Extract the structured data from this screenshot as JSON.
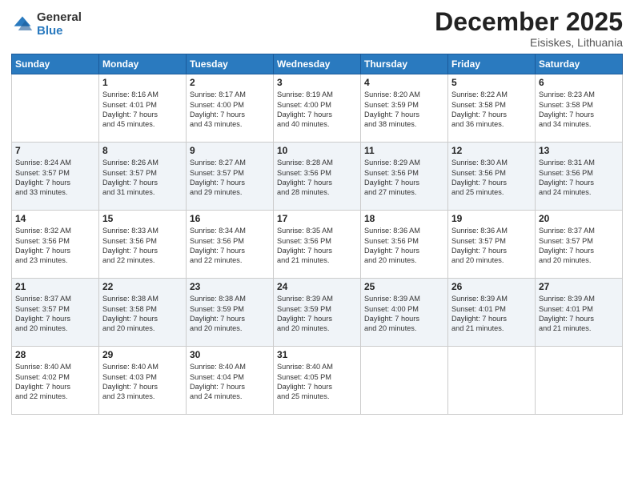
{
  "logo": {
    "general": "General",
    "blue": "Blue"
  },
  "title": "December 2025",
  "subtitle": "Eisiskes, Lithuania",
  "days": [
    "Sunday",
    "Monday",
    "Tuesday",
    "Wednesday",
    "Thursday",
    "Friday",
    "Saturday"
  ],
  "weeks": [
    [
      {
        "day": "",
        "content": ""
      },
      {
        "day": "1",
        "content": "Sunrise: 8:16 AM\nSunset: 4:01 PM\nDaylight: 7 hours\nand 45 minutes."
      },
      {
        "day": "2",
        "content": "Sunrise: 8:17 AM\nSunset: 4:00 PM\nDaylight: 7 hours\nand 43 minutes."
      },
      {
        "day": "3",
        "content": "Sunrise: 8:19 AM\nSunset: 4:00 PM\nDaylight: 7 hours\nand 40 minutes."
      },
      {
        "day": "4",
        "content": "Sunrise: 8:20 AM\nSunset: 3:59 PM\nDaylight: 7 hours\nand 38 minutes."
      },
      {
        "day": "5",
        "content": "Sunrise: 8:22 AM\nSunset: 3:58 PM\nDaylight: 7 hours\nand 36 minutes."
      },
      {
        "day": "6",
        "content": "Sunrise: 8:23 AM\nSunset: 3:58 PM\nDaylight: 7 hours\nand 34 minutes."
      }
    ],
    [
      {
        "day": "7",
        "content": "Sunrise: 8:24 AM\nSunset: 3:57 PM\nDaylight: 7 hours\nand 33 minutes."
      },
      {
        "day": "8",
        "content": "Sunrise: 8:26 AM\nSunset: 3:57 PM\nDaylight: 7 hours\nand 31 minutes."
      },
      {
        "day": "9",
        "content": "Sunrise: 8:27 AM\nSunset: 3:57 PM\nDaylight: 7 hours\nand 29 minutes."
      },
      {
        "day": "10",
        "content": "Sunrise: 8:28 AM\nSunset: 3:56 PM\nDaylight: 7 hours\nand 28 minutes."
      },
      {
        "day": "11",
        "content": "Sunrise: 8:29 AM\nSunset: 3:56 PM\nDaylight: 7 hours\nand 27 minutes."
      },
      {
        "day": "12",
        "content": "Sunrise: 8:30 AM\nSunset: 3:56 PM\nDaylight: 7 hours\nand 25 minutes."
      },
      {
        "day": "13",
        "content": "Sunrise: 8:31 AM\nSunset: 3:56 PM\nDaylight: 7 hours\nand 24 minutes."
      }
    ],
    [
      {
        "day": "14",
        "content": "Sunrise: 8:32 AM\nSunset: 3:56 PM\nDaylight: 7 hours\nand 23 minutes."
      },
      {
        "day": "15",
        "content": "Sunrise: 8:33 AM\nSunset: 3:56 PM\nDaylight: 7 hours\nand 22 minutes."
      },
      {
        "day": "16",
        "content": "Sunrise: 8:34 AM\nSunset: 3:56 PM\nDaylight: 7 hours\nand 22 minutes."
      },
      {
        "day": "17",
        "content": "Sunrise: 8:35 AM\nSunset: 3:56 PM\nDaylight: 7 hours\nand 21 minutes."
      },
      {
        "day": "18",
        "content": "Sunrise: 8:36 AM\nSunset: 3:56 PM\nDaylight: 7 hours\nand 20 minutes."
      },
      {
        "day": "19",
        "content": "Sunrise: 8:36 AM\nSunset: 3:57 PM\nDaylight: 7 hours\nand 20 minutes."
      },
      {
        "day": "20",
        "content": "Sunrise: 8:37 AM\nSunset: 3:57 PM\nDaylight: 7 hours\nand 20 minutes."
      }
    ],
    [
      {
        "day": "21",
        "content": "Sunrise: 8:37 AM\nSunset: 3:57 PM\nDaylight: 7 hours\nand 20 minutes."
      },
      {
        "day": "22",
        "content": "Sunrise: 8:38 AM\nSunset: 3:58 PM\nDaylight: 7 hours\nand 20 minutes."
      },
      {
        "day": "23",
        "content": "Sunrise: 8:38 AM\nSunset: 3:59 PM\nDaylight: 7 hours\nand 20 minutes."
      },
      {
        "day": "24",
        "content": "Sunrise: 8:39 AM\nSunset: 3:59 PM\nDaylight: 7 hours\nand 20 minutes."
      },
      {
        "day": "25",
        "content": "Sunrise: 8:39 AM\nSunset: 4:00 PM\nDaylight: 7 hours\nand 20 minutes."
      },
      {
        "day": "26",
        "content": "Sunrise: 8:39 AM\nSunset: 4:01 PM\nDaylight: 7 hours\nand 21 minutes."
      },
      {
        "day": "27",
        "content": "Sunrise: 8:39 AM\nSunset: 4:01 PM\nDaylight: 7 hours\nand 21 minutes."
      }
    ],
    [
      {
        "day": "28",
        "content": "Sunrise: 8:40 AM\nSunset: 4:02 PM\nDaylight: 7 hours\nand 22 minutes."
      },
      {
        "day": "29",
        "content": "Sunrise: 8:40 AM\nSunset: 4:03 PM\nDaylight: 7 hours\nand 23 minutes."
      },
      {
        "day": "30",
        "content": "Sunrise: 8:40 AM\nSunset: 4:04 PM\nDaylight: 7 hours\nand 24 minutes."
      },
      {
        "day": "31",
        "content": "Sunrise: 8:40 AM\nSunset: 4:05 PM\nDaylight: 7 hours\nand 25 minutes."
      },
      {
        "day": "",
        "content": ""
      },
      {
        "day": "",
        "content": ""
      },
      {
        "day": "",
        "content": ""
      }
    ]
  ]
}
